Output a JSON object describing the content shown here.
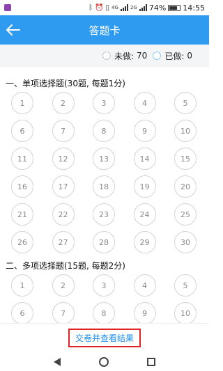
{
  "status_bar": {
    "app_icon_color": "#8e44ad",
    "network_labels": [
      "4G",
      "2G"
    ],
    "battery": "74%",
    "time": "14:55"
  },
  "header": {
    "title": "答题卡",
    "bg_color": "#2f9bf0"
  },
  "legend": {
    "undone_label": "未做:",
    "undone_count": "70",
    "done_label": "已做:",
    "done_count": "0"
  },
  "sections": [
    {
      "title": "一、单项选择题(30题, 每题1分)",
      "questions": [
        "1",
        "2",
        "3",
        "4",
        "5",
        "6",
        "7",
        "8",
        "9",
        "10",
        "11",
        "12",
        "13",
        "14",
        "15",
        "16",
        "17",
        "18",
        "19",
        "20",
        "21",
        "22",
        "23",
        "24",
        "25",
        "26",
        "27",
        "28",
        "29",
        "30"
      ]
    },
    {
      "title": "二、多项选择题(15题, 每题2分)",
      "questions": [
        "1",
        "2",
        "3",
        "4",
        "5",
        "6",
        "7",
        "8",
        "9",
        "10"
      ]
    }
  ],
  "footer": {
    "submit_label": "交卷并查看结果",
    "highlight_color": "#e02222"
  }
}
